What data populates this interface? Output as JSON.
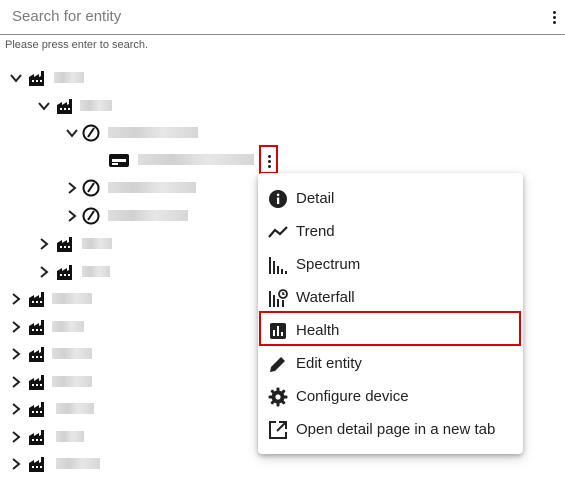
{
  "search": {
    "placeholder": "Search for entity",
    "hint": "Please press enter to search."
  },
  "tree": {
    "nodes": [
      {
        "icon": "factory-icon",
        "expanded": true
      },
      {
        "icon": "factory-icon",
        "expanded": true
      },
      {
        "icon": "gauge-icon",
        "expanded": true
      },
      {
        "icon": "device-card-icon"
      },
      {
        "icon": "gauge-icon",
        "expanded": false
      },
      {
        "icon": "gauge-icon",
        "expanded": false
      },
      {
        "icon": "factory-icon",
        "expanded": false
      },
      {
        "icon": "factory-icon",
        "expanded": false
      },
      {
        "icon": "factory-icon",
        "expanded": false
      },
      {
        "icon": "factory-icon",
        "expanded": false
      },
      {
        "icon": "factory-icon",
        "expanded": false
      },
      {
        "icon": "factory-icon",
        "expanded": false
      },
      {
        "icon": "factory-icon",
        "expanded": false
      },
      {
        "icon": "factory-icon",
        "expanded": false
      },
      {
        "icon": "factory-icon",
        "expanded": false
      }
    ]
  },
  "context_menu": {
    "items": [
      {
        "label": "Detail",
        "icon": "info-icon"
      },
      {
        "label": "Trend",
        "icon": "trend-icon"
      },
      {
        "label": "Spectrum",
        "icon": "spectrum-icon"
      },
      {
        "label": "Waterfall",
        "icon": "waterfall-icon"
      },
      {
        "label": "Health",
        "icon": "health-icon"
      },
      {
        "label": "Edit entity",
        "icon": "pencil-icon"
      },
      {
        "label": "Configure device",
        "icon": "gear-icon"
      },
      {
        "label": "Open detail page in a new tab",
        "icon": "open-in-new-icon"
      }
    ]
  },
  "colors": {
    "highlight": "#d80000",
    "text": "#212121"
  }
}
